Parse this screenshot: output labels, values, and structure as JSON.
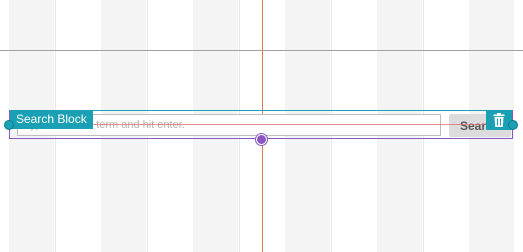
{
  "search_block": {
    "label": "Search Block",
    "input_placeholder": "Type a search term and hit enter.",
    "input_value": "",
    "button_label": "Search",
    "delete_icon": "trash-icon"
  },
  "colors": {
    "block_accent": "#19a0b4",
    "selection_outline": "#8a57c4",
    "guide_line": "#e07a55",
    "button_bg": "#dcdcdc"
  }
}
